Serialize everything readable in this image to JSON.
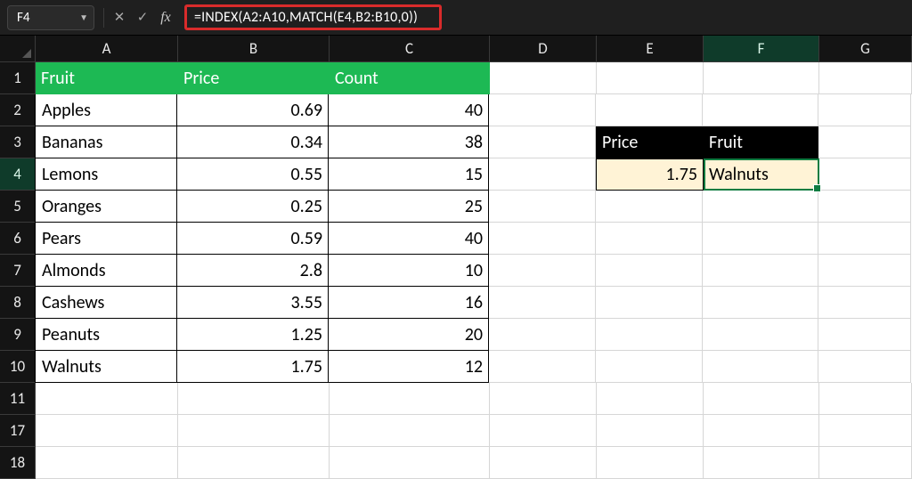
{
  "formula_bar": {
    "cell_ref": "F4",
    "cancel": "✕",
    "enter": "✓",
    "fx": "fx",
    "formula": "=INDEX(A2:A10,MATCH(E4,B2:B10,0))"
  },
  "columns": [
    "A",
    "B",
    "C",
    "D",
    "E",
    "F",
    "G"
  ],
  "rows": [
    "1",
    "2",
    "3",
    "4",
    "5",
    "6",
    "7",
    "8",
    "9",
    "10",
    "11",
    "17",
    "18"
  ],
  "active_column": "F",
  "active_row": "4",
  "table": {
    "headers": {
      "a": "Fruit",
      "b": "Price",
      "c": "Count"
    },
    "data": [
      {
        "a": "Apples",
        "b": "0.69",
        "c": "40"
      },
      {
        "a": "Bananas",
        "b": "0.34",
        "c": "38"
      },
      {
        "a": "Lemons",
        "b": "0.55",
        "c": "15"
      },
      {
        "a": "Oranges",
        "b": "0.25",
        "c": "25"
      },
      {
        "a": "Pears",
        "b": "0.59",
        "c": "40"
      },
      {
        "a": "Almonds",
        "b": "2.8",
        "c": "10"
      },
      {
        "a": "Cashews",
        "b": "3.55",
        "c": "16"
      },
      {
        "a": "Peanuts",
        "b": "1.25",
        "c": "20"
      },
      {
        "a": "Walnuts",
        "b": "1.75",
        "c": "12"
      }
    ]
  },
  "lookup": {
    "headers": {
      "e": "Price",
      "f": "Fruit"
    },
    "values": {
      "e": "1.75",
      "f": "Walnuts"
    }
  }
}
